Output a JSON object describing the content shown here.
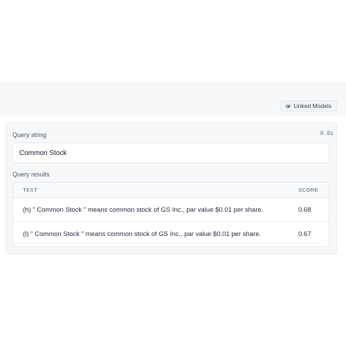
{
  "toolbar": {
    "linked_models_label": "Linked Models",
    "linked_models_icon": "cube-icon"
  },
  "query": {
    "label": "Query string",
    "timing": "0.0s",
    "value": "Common Stock"
  },
  "results": {
    "label": "Query results",
    "columns": [
      "TEXT",
      "SCORE"
    ],
    "rows": [
      {
        "text": "(h) \" Common Stock \" means common stock of GS Inc., par value $0.01 per share.",
        "score": "0.68"
      },
      {
        "text": "(l) \" Common Stock \" means common stock of GS Inc., par value $0.01 per share.",
        "score": "0.67"
      }
    ]
  }
}
